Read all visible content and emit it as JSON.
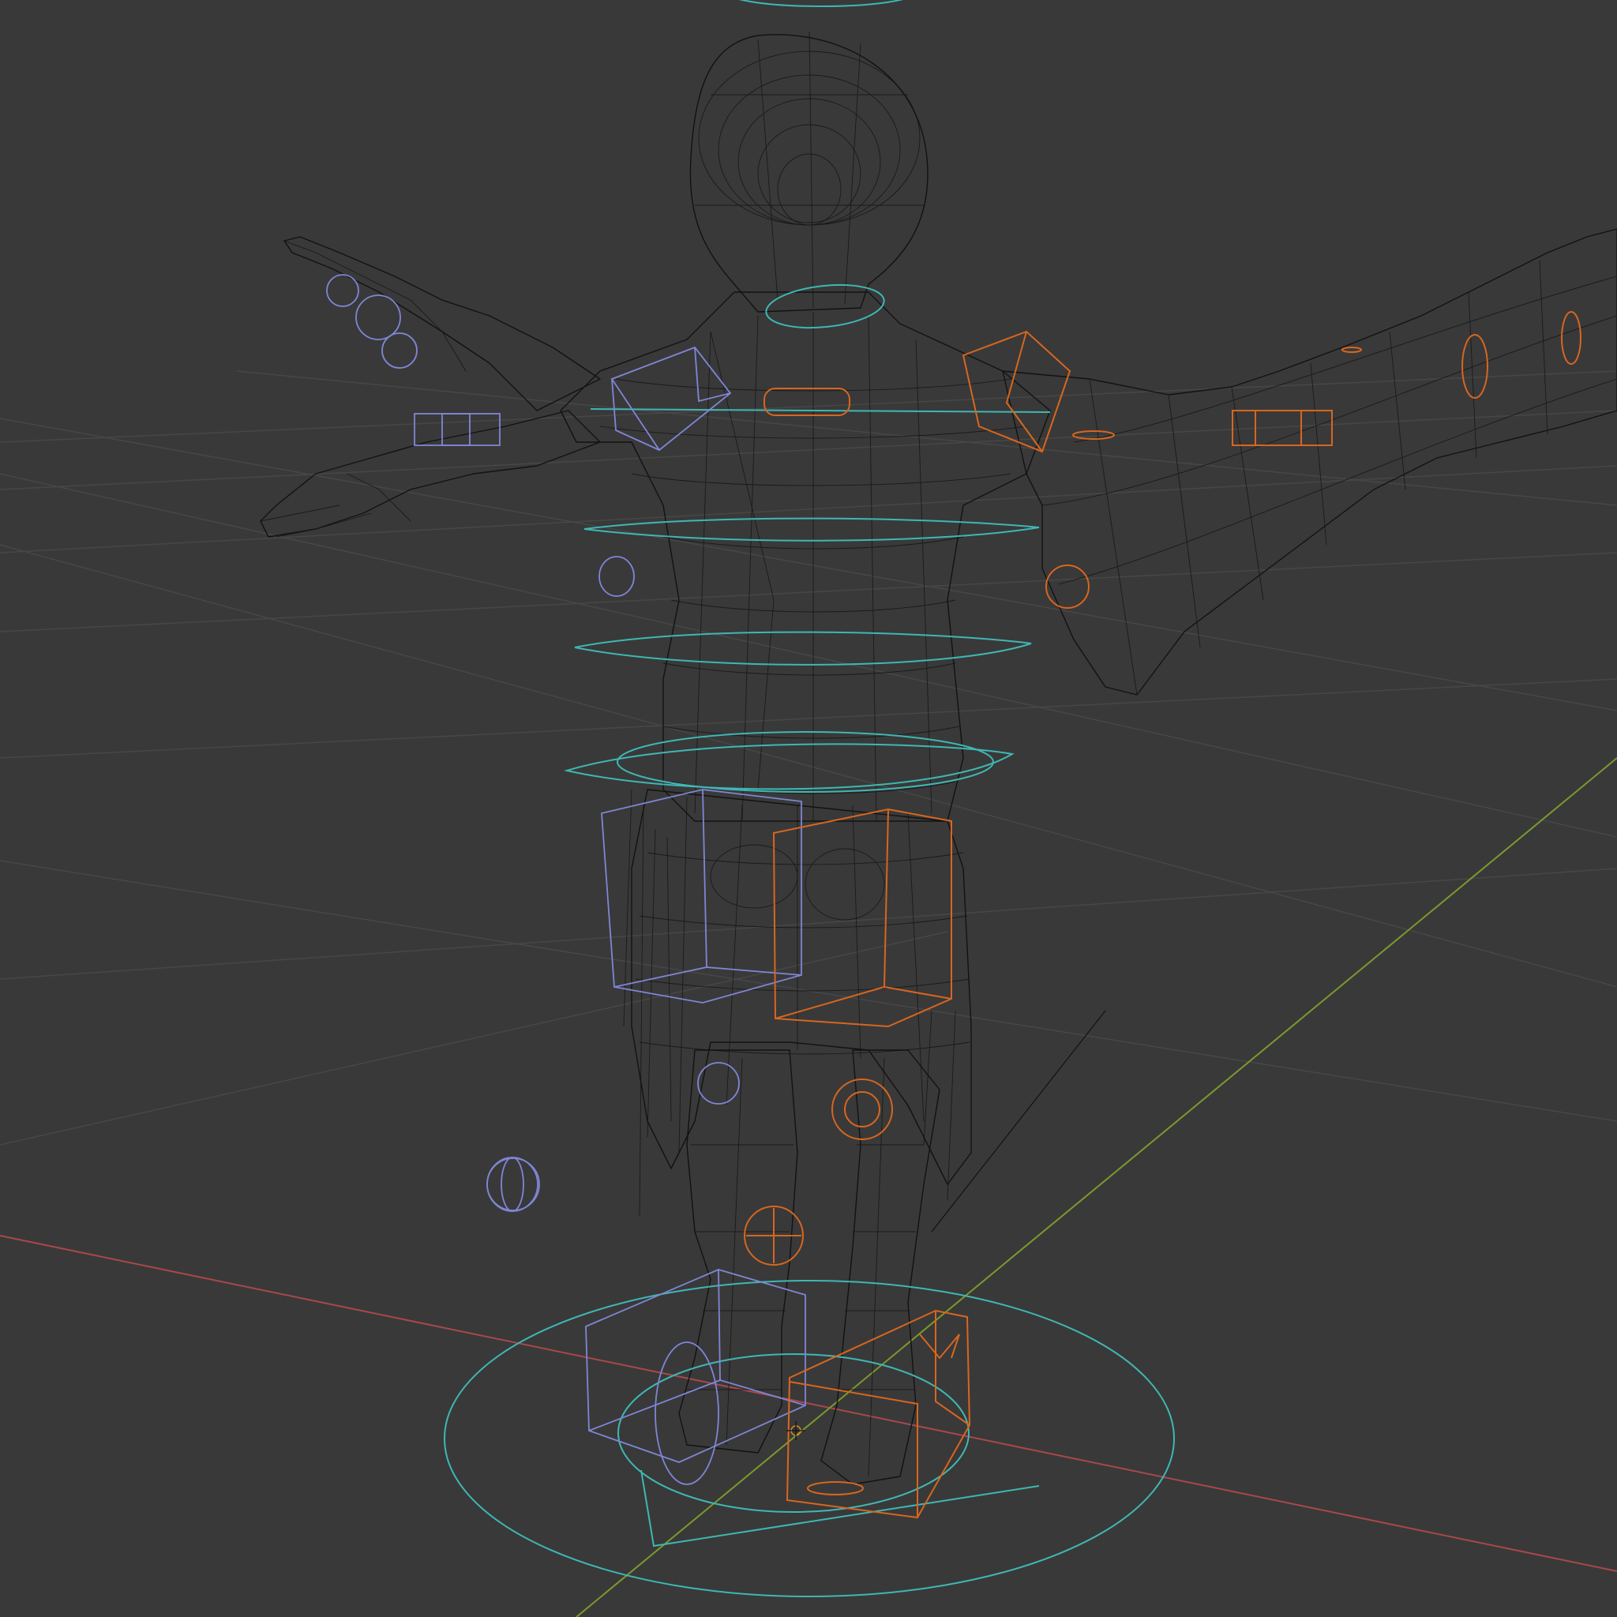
{
  "viewport": {
    "mode": "wireframe",
    "background_color": "#393939",
    "grid_color": "#474747",
    "x_axis_color": "#a8484b",
    "y_axis_color": "#7a9a2c",
    "mesh_color": "#121212"
  },
  "rig": {
    "controller_colors": {
      "center": "#3fb7b4",
      "left_side": "#7f86d6",
      "right_side": "#d7661f"
    }
  }
}
